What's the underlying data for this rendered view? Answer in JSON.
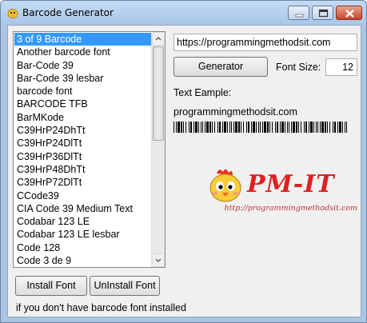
{
  "window": {
    "title": "Barcode Generator"
  },
  "fonts_list": {
    "selected_index": 0,
    "items": [
      "3 of 9 Barcode",
      "Another barcode font",
      "Bar-Code 39",
      "Bar-Code 39 lesbar",
      "barcode font",
      "BARCODE TFB",
      "BarMKode",
      "C39HrP24DhTt",
      "C39HrP24DlTt",
      "C39HrP36DlTt",
      "C39HrP48DhTt",
      "C39HrP72DlTt",
      "CCode39",
      "CIA Code 39 Medium Text",
      "Codabar 123 LE",
      "Codabar 123 LE lesbar",
      "Code 128",
      "Code 3 de 9"
    ]
  },
  "buttons": {
    "install": "Install Font",
    "uninstall": "UnInstall Font",
    "generator": "Generator"
  },
  "hint": "if you don't have barcode font installed",
  "url_input": {
    "value": "https://programmingmethodsit.com"
  },
  "font_size": {
    "label": "Font Size:",
    "value": "12"
  },
  "preview": {
    "label": "Text Eample:",
    "text": "programmingmethodsit.com"
  },
  "logo": {
    "name": "PM-IT",
    "url": "http://programmingmethodsit.com"
  },
  "colors": {
    "selection": "#3399ff",
    "logo": "#e02020"
  }
}
